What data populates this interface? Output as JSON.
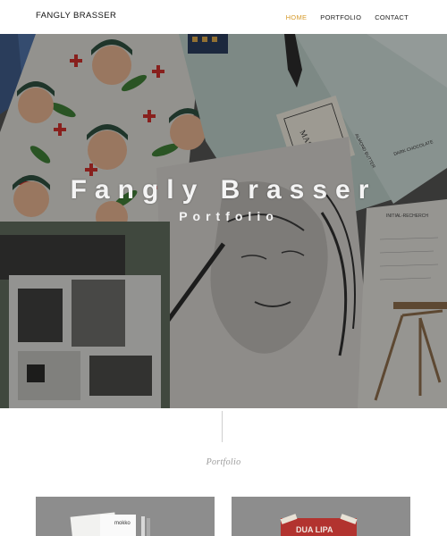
{
  "header": {
    "brand": "FANGLY BRASSER",
    "nav": [
      {
        "label": "HOME",
        "active": true
      },
      {
        "label": "PORTFOLIO",
        "active": false
      },
      {
        "label": "CONTACT",
        "active": false
      }
    ]
  },
  "hero": {
    "title": "Fangly Brasser",
    "subtitle": "Portfolio"
  },
  "section": {
    "label": "Portfolio"
  },
  "hero_artwork_text": {
    "mast_label": "MAST",
    "almond_label": "ALMOND BUTTER",
    "chocolate_label": "DARK CHOCOLATE",
    "notes_title": "INITIAL-RECHERCH"
  },
  "cards": [
    {
      "caption": "mokko"
    },
    {
      "caption": "DUA LIPA"
    }
  ],
  "colors": {
    "accent": "#d69b2c",
    "card_bg": "#8d8d8d"
  }
}
